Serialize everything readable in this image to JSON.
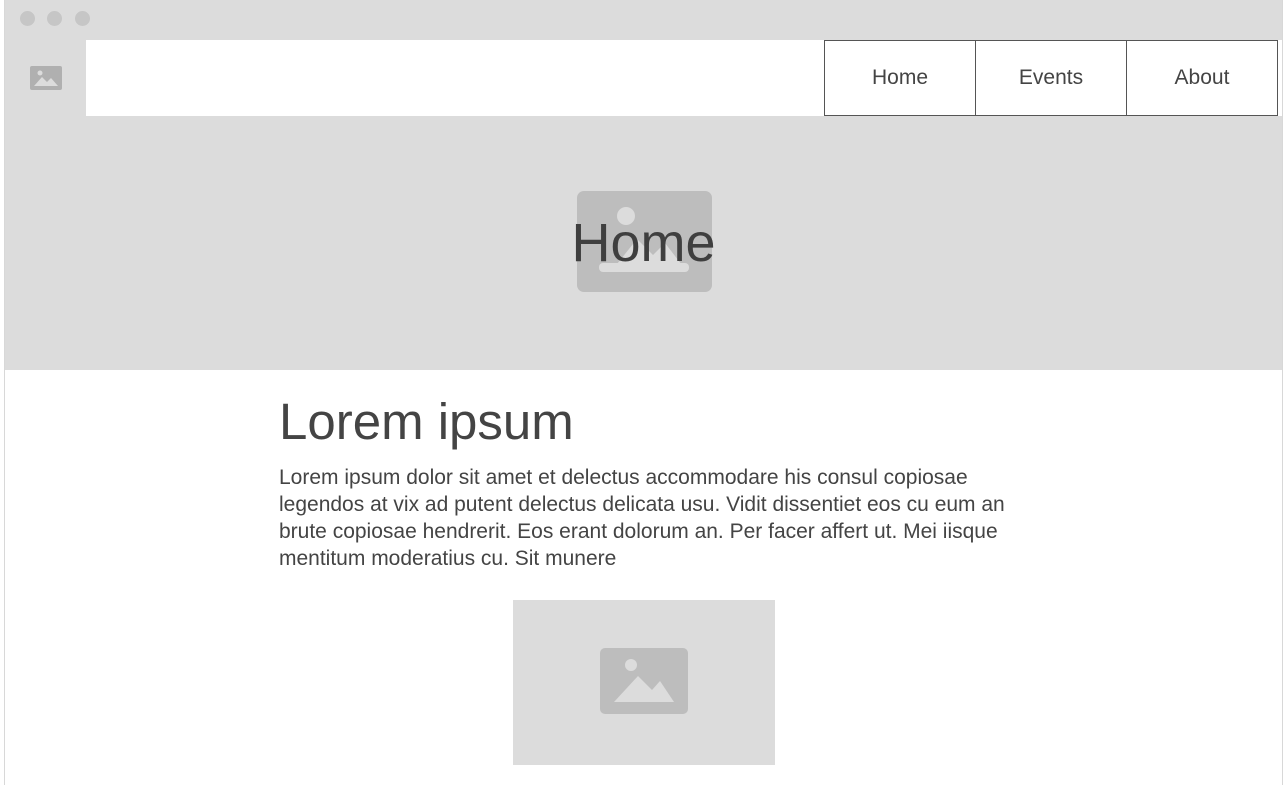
{
  "nav": {
    "items": [
      {
        "label": "Home"
      },
      {
        "label": "Events"
      },
      {
        "label": "About"
      }
    ]
  },
  "hero": {
    "title": "Home"
  },
  "main": {
    "heading": "Lorem ipsum",
    "body": "Lorem ipsum dolor sit amet et delectus accommodare his consul copiosae legendos at vix ad putent delectus delicata usu. Vidit dissentiet eos cu eum an brute copiosae hendrerit. Eos erant dolorum an. Per facer affert ut. Mei iisque mentitum moderatius cu. Sit munere"
  },
  "icons": {
    "logo": "image-placeholder-icon",
    "hero": "image-placeholder-icon",
    "content": "image-placeholder-icon"
  },
  "colors": {
    "placeholder_bg": "#dcdcdc",
    "placeholder_icon": "#bdbdbd",
    "text": "#444444"
  }
}
